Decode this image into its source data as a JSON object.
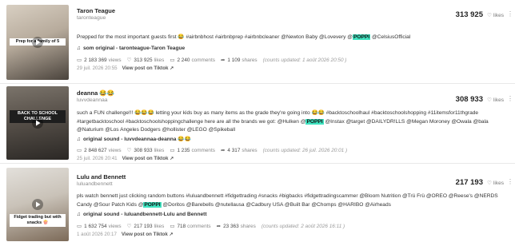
{
  "posts": [
    {
      "author": "Taron Teague",
      "handle": "taronteague",
      "likes_display": "313 925",
      "likes_label": "likes",
      "thumb_caption": "Prep for a family of 5",
      "thumb_colors": [
        "#cfc4b4",
        "#3e3a36"
      ],
      "caption_before": "Prepped for the most important guests first 😂 #airbnbhost #airbnbprep #airbnbcleaner @Newton Baby @Lovevery @",
      "caption_highlight": "POPPI",
      "caption_after": " @CelsiusOfficial",
      "caption2_before": "",
      "caption2_highlight": "",
      "caption2_after": "",
      "sound": "som original - taronteague-Taron Teague",
      "views": "2 183 369",
      "likes": "313 925",
      "comments": "2 240",
      "shares": "1 109",
      "updated": "(counts updated: 1 août 2026 20:50 )",
      "date": "29 juil. 2026 20:55",
      "view_link": "View post on Tiktok"
    },
    {
      "author": "deanna 😂😂",
      "handle": "luvvdeannaa",
      "likes_display": "308 933",
      "likes_label": "likes",
      "thumb_caption": "BACK TO SCHOOL CHALLENGE",
      "thumb_colors": [
        "#6b6660",
        "#2f2c28"
      ],
      "caption_before": "such a FUN challenge!!! 😂😂😂 letting your kids buy as many items as the grade they're going into 😂😂 #backtoschoolhaul #backtoschoolshopping #11itemsfor11thgrade #targetbacktoschool #backtoschoolshoppingchallenge here are all the brands we got: @Hulken @",
      "caption_highlight": "POPPI",
      "caption_after": " @Instax @target @DAILYDR!LLS @Megan Moroney @Owala @bala @Naturium @Los Angeles Dodgers @hollister @LEGO @Spikeball",
      "caption2_before": "",
      "caption2_highlight": "",
      "caption2_after": "",
      "sound": "original sound - luvvdeannaa-deanna 😂😂",
      "views": "2 848 627",
      "likes": "308 933",
      "comments": "1 235",
      "shares": "4 317",
      "updated": "(counts updated: 26 juil. 2026 20:01 )",
      "date": "25 juil. 2026 20:41",
      "view_link": "View post on Tiktok"
    },
    {
      "author": "Lulu and Bennett",
      "handle": "luluandbennett",
      "likes_display": "217 193",
      "likes_label": "likes",
      "thumb_caption": "Fidget trading but with snacks 🍿",
      "thumb_colors": [
        "#d9d6d1",
        "#8d7a66"
      ],
      "caption_before": "pls watch bennett just clicking random buttons #luluandbennett #fidgettrading #snacks #bigbacks #fidgettradingscammer @Bloom Nutrition @Trü Frü @OREO @Reese's @NERDS Candy @Sour Patch Kids @",
      "caption_highlight": "POPPI",
      "caption_after": " @Doritos @Barebells @nutellausa @Cadbury USA @Built Bar @Chomps @HARIBO @Airheads",
      "caption2_before": "",
      "caption2_highlight": "",
      "caption2_after": "",
      "sound": "original sound - luluandbennett-Lulu and Bennett",
      "views": "1 632 754",
      "likes": "217 193",
      "comments": "718",
      "shares": "23 363",
      "updated": "(counts updated: 2 août 2026 16:11 )",
      "date": "1 août 2026 20:17",
      "view_link": "View post on Tiktok"
    }
  ],
  "labels": {
    "views": "views",
    "likes": "likes",
    "comments": "comments",
    "shares": "shares"
  }
}
